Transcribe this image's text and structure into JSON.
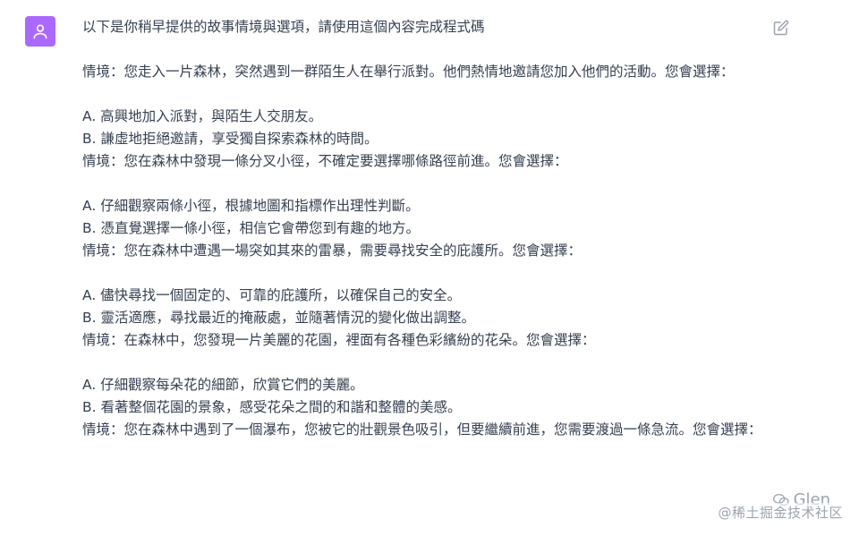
{
  "message": {
    "intro": "以下是你稍早提供的故事情境與選項，請使用這個內容完成程式碼",
    "lines": [
      "情境：您走入一片森林，突然遇到一群陌生人在舉行派對。他們熱情地邀請您加入他們的活動。您會選擇：",
      "",
      "A. 高興地加入派對，與陌生人交朋友。",
      "B. 謙虛地拒絕邀請，享受獨自探索森林的時間。",
      "情境：您在森林中發現一條分叉小徑，不確定要選擇哪條路徑前進。您會選擇：",
      "",
      "A. 仔細觀察兩條小徑，根據地圖和指標作出理性判斷。",
      "B. 憑直覺選擇一條小徑，相信它會帶您到有趣的地方。",
      "情境：您在森林中遭遇一場突如其來的雷暴，需要尋找安全的庇護所。您會選擇：",
      "",
      "A. 儘快尋找一個固定的、可靠的庇護所，以確保自己的安全。",
      "B. 靈活適應，尋找最近的掩蔽處，並隨著情況的變化做出調整。",
      "情境：在森林中，您發現一片美麗的花園，裡面有各種色彩繽紛的花朵。您會選擇：",
      "",
      "A. 仔細觀察每朵花的細節，欣賞它們的美麗。",
      "B. 看著整個花園的景象，感受花朵之間的和諧和整體的美感。",
      "情境：您在森林中遇到了一個瀑布，您被它的壯觀景色吸引，但要繼續前進，您需要渡過一條急流。您會選擇："
    ]
  },
  "watermark": {
    "account": "Glen",
    "site": "@稀土掘金技术社区"
  },
  "icons": {
    "avatar": "user-icon",
    "edit": "edit-icon"
  },
  "colors": {
    "avatar_bg": "#ab68ff",
    "text": "#374151",
    "icon_gray": "#9ca3af"
  }
}
